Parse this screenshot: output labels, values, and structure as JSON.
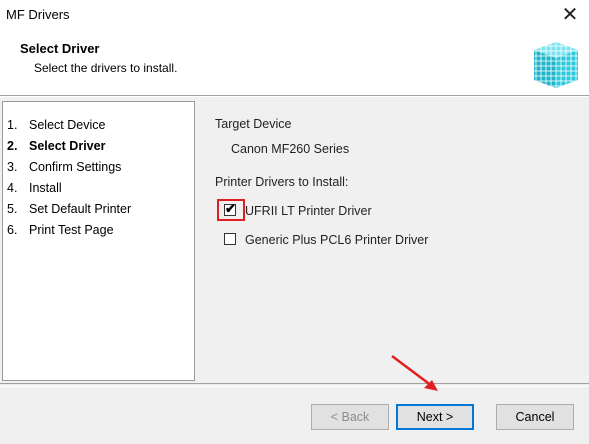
{
  "window": {
    "title": "MF Drivers",
    "close_icon": "close-icon"
  },
  "header": {
    "title": "Select Driver",
    "subtitle": "Select the drivers to install.",
    "logo_icon": "cube-logo-icon"
  },
  "steps": [
    {
      "num": "1.",
      "label": "Select Device",
      "active": false
    },
    {
      "num": "2.",
      "label": "Select Driver",
      "active": true
    },
    {
      "num": "3.",
      "label": "Confirm Settings",
      "active": false
    },
    {
      "num": "4.",
      "label": "Install",
      "active": false
    },
    {
      "num": "5.",
      "label": "Set Default Printer",
      "active": false
    },
    {
      "num": "6.",
      "label": "Print Test Page",
      "active": false
    }
  ],
  "target": {
    "label": "Target Device",
    "device": "Canon MF260 Series"
  },
  "drivers": {
    "label": "Printer Drivers to Install:",
    "items": [
      {
        "label": "UFRII LT Printer Driver",
        "checked": true
      },
      {
        "label": "Generic Plus PCL6 Printer Driver",
        "checked": false
      }
    ]
  },
  "buttons": {
    "back": "< Back",
    "next": "Next >",
    "cancel": "Cancel"
  },
  "annotation": {
    "highlight_color": "#e02020",
    "arrow_icon": "red-arrow-icon"
  }
}
